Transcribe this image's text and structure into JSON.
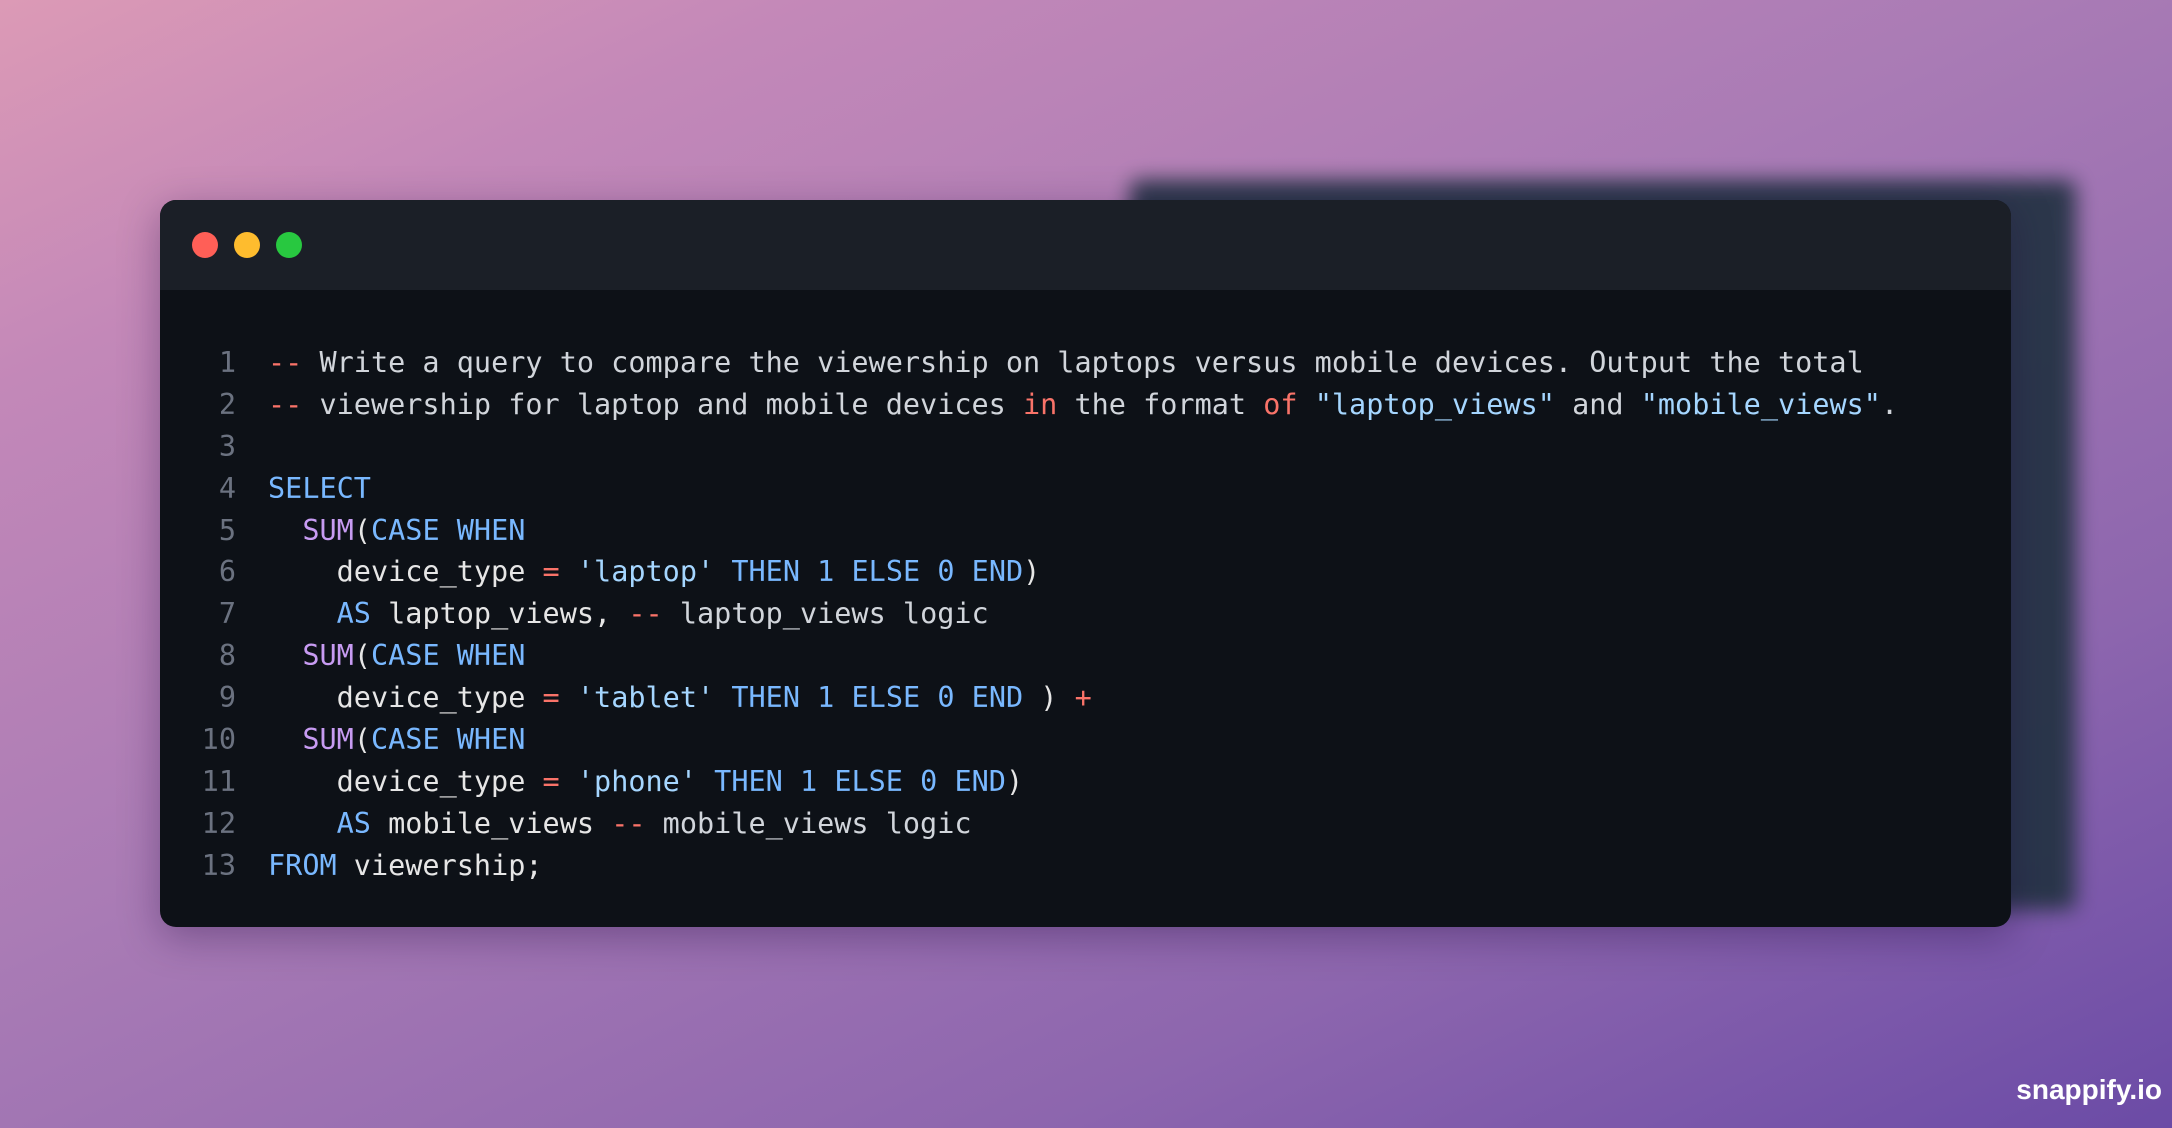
{
  "window": {
    "controls": [
      {
        "name": "close-button",
        "color": "#ff5f57"
      },
      {
        "name": "minimize-button",
        "color": "#febc2e"
      },
      {
        "name": "maximize-button",
        "color": "#28c840"
      }
    ]
  },
  "code": {
    "language": "sql",
    "lines": [
      {
        "n": "1",
        "tokens": [
          {
            "t": "--",
            "k": "op"
          },
          {
            "t": " Write a query to compare the viewership on laptops versus mobile devices. Output the total",
            "k": "comment"
          }
        ]
      },
      {
        "n": "2",
        "tokens": [
          {
            "t": "--",
            "k": "op"
          },
          {
            "t": " viewership for laptop and mobile devices ",
            "k": "comment"
          },
          {
            "t": "in",
            "k": "op"
          },
          {
            "t": " the format ",
            "k": "comment"
          },
          {
            "t": "of",
            "k": "op"
          },
          {
            "t": " ",
            "k": "comment"
          },
          {
            "t": "\"laptop_views\"",
            "k": "str"
          },
          {
            "t": " and ",
            "k": "comment"
          },
          {
            "t": "\"mobile_views\"",
            "k": "str"
          },
          {
            "t": ".",
            "k": "comment"
          }
        ]
      },
      {
        "n": "3",
        "tokens": []
      },
      {
        "n": "4",
        "tokens": [
          {
            "t": "SELECT",
            "k": "kw"
          }
        ]
      },
      {
        "n": "5",
        "tokens": [
          {
            "t": "  ",
            "k": "id"
          },
          {
            "t": "SUM",
            "k": "fn"
          },
          {
            "t": "(",
            "k": "id"
          },
          {
            "t": "CASE WHEN",
            "k": "kw"
          }
        ]
      },
      {
        "n": "6",
        "tokens": [
          {
            "t": "    device_type ",
            "k": "id"
          },
          {
            "t": "=",
            "k": "op"
          },
          {
            "t": " ",
            "k": "id"
          },
          {
            "t": "'laptop'",
            "k": "str"
          },
          {
            "t": " ",
            "k": "id"
          },
          {
            "t": "THEN",
            "k": "kw"
          },
          {
            "t": " ",
            "k": "id"
          },
          {
            "t": "1",
            "k": "num"
          },
          {
            "t": " ",
            "k": "id"
          },
          {
            "t": "ELSE",
            "k": "kw"
          },
          {
            "t": " ",
            "k": "id"
          },
          {
            "t": "0",
            "k": "num"
          },
          {
            "t": " ",
            "k": "id"
          },
          {
            "t": "END",
            "k": "kw"
          },
          {
            "t": ")",
            "k": "id"
          }
        ]
      },
      {
        "n": "7",
        "tokens": [
          {
            "t": "    ",
            "k": "id"
          },
          {
            "t": "AS",
            "k": "kw"
          },
          {
            "t": " laptop_views, ",
            "k": "id"
          },
          {
            "t": "--",
            "k": "op"
          },
          {
            "t": " laptop_views logic",
            "k": "comment"
          }
        ]
      },
      {
        "n": "8",
        "tokens": [
          {
            "t": "  ",
            "k": "id"
          },
          {
            "t": "SUM",
            "k": "fn"
          },
          {
            "t": "(",
            "k": "id"
          },
          {
            "t": "CASE WHEN",
            "k": "kw"
          }
        ]
      },
      {
        "n": "9",
        "tokens": [
          {
            "t": "    device_type ",
            "k": "id"
          },
          {
            "t": "=",
            "k": "op"
          },
          {
            "t": " ",
            "k": "id"
          },
          {
            "t": "'tablet'",
            "k": "str"
          },
          {
            "t": " ",
            "k": "id"
          },
          {
            "t": "THEN",
            "k": "kw"
          },
          {
            "t": " ",
            "k": "id"
          },
          {
            "t": "1",
            "k": "num"
          },
          {
            "t": " ",
            "k": "id"
          },
          {
            "t": "ELSE",
            "k": "kw"
          },
          {
            "t": " ",
            "k": "id"
          },
          {
            "t": "0",
            "k": "num"
          },
          {
            "t": " ",
            "k": "id"
          },
          {
            "t": "END",
            "k": "kw"
          },
          {
            "t": " ) ",
            "k": "id"
          },
          {
            "t": "+",
            "k": "op"
          }
        ]
      },
      {
        "n": "10",
        "tokens": [
          {
            "t": "  ",
            "k": "id"
          },
          {
            "t": "SUM",
            "k": "fn"
          },
          {
            "t": "(",
            "k": "id"
          },
          {
            "t": "CASE WHEN",
            "k": "kw"
          }
        ]
      },
      {
        "n": "11",
        "tokens": [
          {
            "t": "    device_type ",
            "k": "id"
          },
          {
            "t": "=",
            "k": "op"
          },
          {
            "t": " ",
            "k": "id"
          },
          {
            "t": "'phone'",
            "k": "str"
          },
          {
            "t": " ",
            "k": "id"
          },
          {
            "t": "THEN",
            "k": "kw"
          },
          {
            "t": " ",
            "k": "id"
          },
          {
            "t": "1",
            "k": "num"
          },
          {
            "t": " ",
            "k": "id"
          },
          {
            "t": "ELSE",
            "k": "kw"
          },
          {
            "t": " ",
            "k": "id"
          },
          {
            "t": "0",
            "k": "num"
          },
          {
            "t": " ",
            "k": "id"
          },
          {
            "t": "END",
            "k": "kw"
          },
          {
            "t": ")",
            "k": "id"
          }
        ]
      },
      {
        "n": "12",
        "tokens": [
          {
            "t": "    ",
            "k": "id"
          },
          {
            "t": "AS",
            "k": "kw"
          },
          {
            "t": " mobile_views ",
            "k": "id"
          },
          {
            "t": "--",
            "k": "op"
          },
          {
            "t": " mobile_views logic",
            "k": "comment"
          }
        ]
      },
      {
        "n": "13",
        "tokens": [
          {
            "t": "FROM",
            "k": "kw"
          },
          {
            "t": " viewership;",
            "k": "id"
          }
        ]
      }
    ]
  },
  "colors": {
    "background_top_left": "#dc9ab6",
    "background_bottom_right": "#6b4ba6",
    "window_bg": "#0d1117",
    "titlebar_bg": "#1b1f27",
    "keyword": "#79b8ff",
    "function": "#c79bf2",
    "operator": "#f97369",
    "string": "#a5d6ff",
    "comment": "#d1d5db"
  },
  "watermark": "snappify.io"
}
